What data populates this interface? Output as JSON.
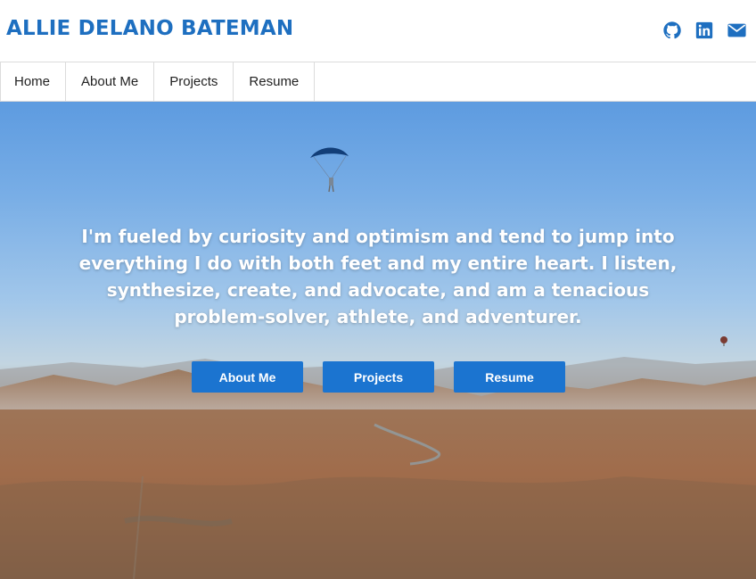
{
  "header": {
    "site_title": "ALLIE DELANO BATEMAN",
    "social_icons": [
      "github-icon",
      "linkedin-icon",
      "envelope-icon"
    ],
    "accent_color": "#1e6fc0"
  },
  "nav": {
    "items": [
      {
        "label": "Home"
      },
      {
        "label": "About Me"
      },
      {
        "label": "Projects"
      },
      {
        "label": "Resume"
      }
    ]
  },
  "hero": {
    "tagline": "I'm fueled by curiosity and optimism and tend to jump into everything I do with both feet and my entire heart. I listen, synthesize, create, and advocate, and am a tenacious problem-solver, athlete, and adventurer.",
    "buttons": [
      {
        "label": "About Me"
      },
      {
        "label": "Projects"
      },
      {
        "label": "Resume"
      }
    ],
    "button_color": "#1b74d0"
  }
}
